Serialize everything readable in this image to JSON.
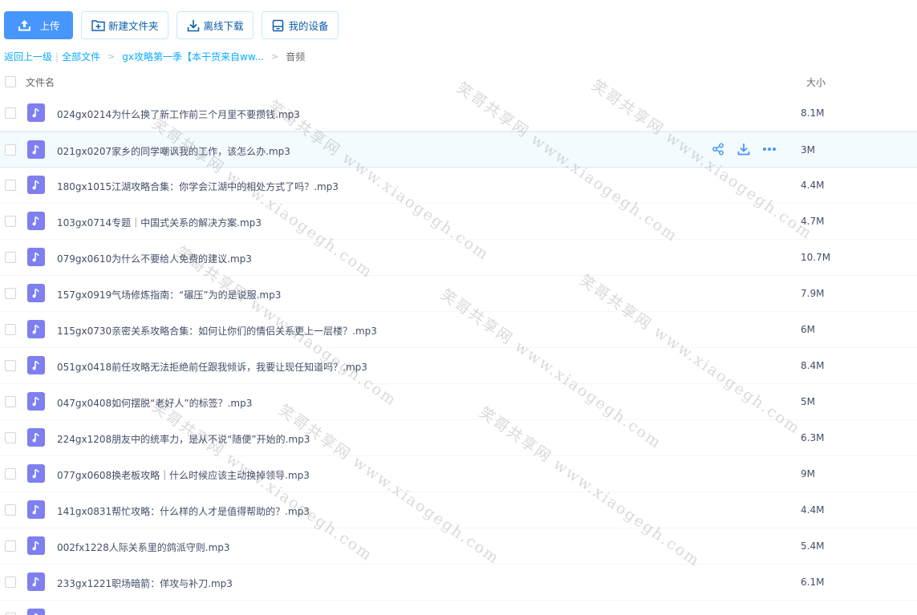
{
  "toolbar": {
    "upload_label": "上传",
    "new_folder_label": "新建文件夹",
    "offline_download_label": "离线下载",
    "my_devices_label": "我的设备"
  },
  "breadcrumb": {
    "back_label": "返回上一级",
    "all_files_label": "全部文件",
    "folder_label": "gx攻略第一季【本干货来自ww...",
    "current_label": "音频"
  },
  "header": {
    "name_label": "文件名",
    "size_label": "大小"
  },
  "files": [
    {
      "name": "024gx0214为什么换了新工作前三个月里不要攒钱.mp3",
      "size": "8.1M"
    },
    {
      "name": "021gx0207家乡的同学嘲讽我的工作，该怎么办.mp3",
      "size": "3M"
    },
    {
      "name": "180gx1015江湖攻略合集：你学会江湖中的相处方式了吗？.mp3",
      "size": "4.4M"
    },
    {
      "name": "103gx0714专题｜中国式关系的解决方案.mp3",
      "size": "4.7M"
    },
    {
      "name": "079gx0610为什么不要给人免费的建议.mp3",
      "size": "10.7M"
    },
    {
      "name": "157gx0919气场修炼指南：“碾压”为的是说服.mp3",
      "size": "7.9M"
    },
    {
      "name": "115gx0730亲密关系攻略合集：如何让你们的情侣关系更上一层楼？.mp3",
      "size": "6M"
    },
    {
      "name": "051gx0418前任攻略无法拒绝前任跟我倾诉，我要让现任知道吗？.mp3",
      "size": "8.4M"
    },
    {
      "name": "047gx0408如何摆脱“老好人”的标签？.mp3",
      "size": "5M"
    },
    {
      "name": "224gx1208朋友中的统率力，是从不说“随便”开始的.mp3",
      "size": "6.3M"
    },
    {
      "name": "077gx0608换老板攻略｜什么时候应该主动换掉领导.mp3",
      "size": "9M"
    },
    {
      "name": "141gx0831帮忙攻略：什么样的人才是值得帮助的？.mp3",
      "size": "4.4M"
    },
    {
      "name": "002fx1228人际关系里的鸽派守则.mp3",
      "size": "5.4M"
    },
    {
      "name": "233gx1221职场暗箭：佯攻与补刀.mp3",
      "size": "6.1M"
    },
    {
      "name": "",
      "size": ""
    }
  ],
  "hover_row_index": 1,
  "icons": {
    "upload": "upload-icon",
    "new_folder": "folder-plus-icon",
    "offline_download": "download-icon",
    "my_devices": "device-icon",
    "file_type": "music-note-icon",
    "share": "share-icon",
    "download": "download-icon",
    "more": "more-icon"
  },
  "colors": {
    "primary": "#4796fb",
    "link": "#09aaff",
    "audio_icon": "#7f7fef",
    "hover_row": "#f4fbff"
  },
  "watermark": {
    "text": "笑哥共享网 www.xiaogegh.com"
  }
}
